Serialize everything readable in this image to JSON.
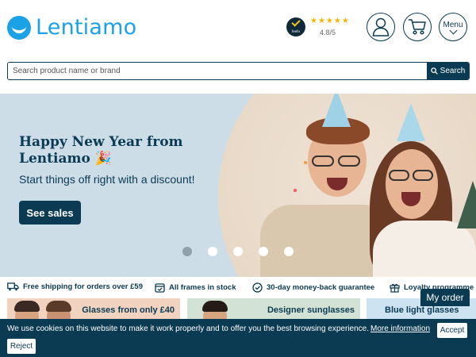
{
  "header": {
    "logo_text": "Lentiamo",
    "feefo_label": "feefo",
    "stars": "★★★★★",
    "rating": "4.8/5",
    "menu_label": "Menu"
  },
  "search": {
    "placeholder": "Search product name or brand",
    "button_label": "Search"
  },
  "hero": {
    "title": "Happy New Year from Lentiamo 🎉",
    "subtitle": "Start things off right with a discount!",
    "cta_label": "See sales",
    "slides": 5,
    "active_slide": 1
  },
  "usp": [
    "Free shipping for orders over £59",
    "All frames in stock",
    "30-day money-back guarantee",
    "Loyalty programme"
  ],
  "tiles": [
    "Glasses from only £40",
    "Designer sunglasses",
    "Blue light glasses"
  ],
  "my_order_label": "My order",
  "cookie": {
    "text": "We use cookies on this website to make it work properly and to offer you the best browsing experience.",
    "more_info": "More information",
    "accept": "Accept",
    "reject": "Reject"
  },
  "colors": {
    "brand_blue": "#1aa1e6",
    "navy": "#0b3a53",
    "hero_bg": "#ccdde8"
  }
}
